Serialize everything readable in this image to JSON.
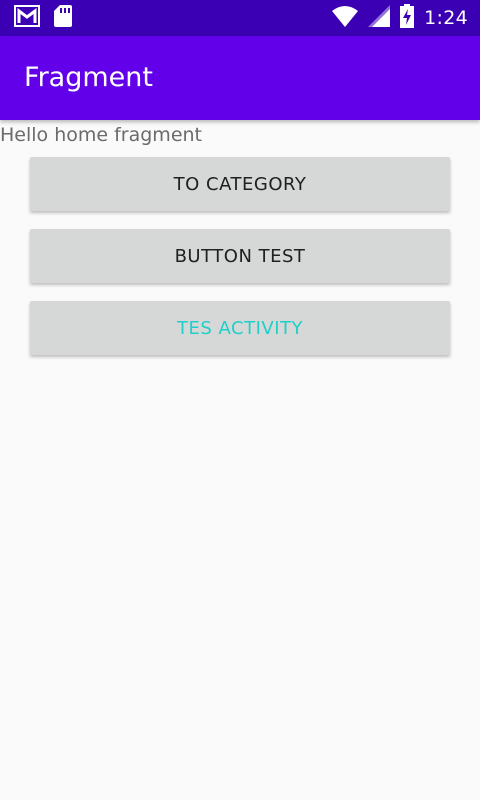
{
  "status_bar": {
    "time": "1:24",
    "icons": [
      "gmail-icon",
      "sd-card-icon",
      "wifi-icon",
      "cell-signal-icon",
      "battery-charging-icon"
    ]
  },
  "app_bar": {
    "title": "Fragment"
  },
  "main": {
    "hello_text": "Hello home fragment",
    "buttons": [
      {
        "label": "TO CATEGORY",
        "text_color": "#202020"
      },
      {
        "label": "BUTTON TEST",
        "text_color": "#202020"
      },
      {
        "label": "TES ACTIVITY",
        "text_color": "#1fd0c8"
      }
    ]
  },
  "colors": {
    "status_bar": "#3b00b3",
    "app_bar": "#6200ea",
    "background": "#fafafa",
    "button": "#d6d7d7"
  }
}
